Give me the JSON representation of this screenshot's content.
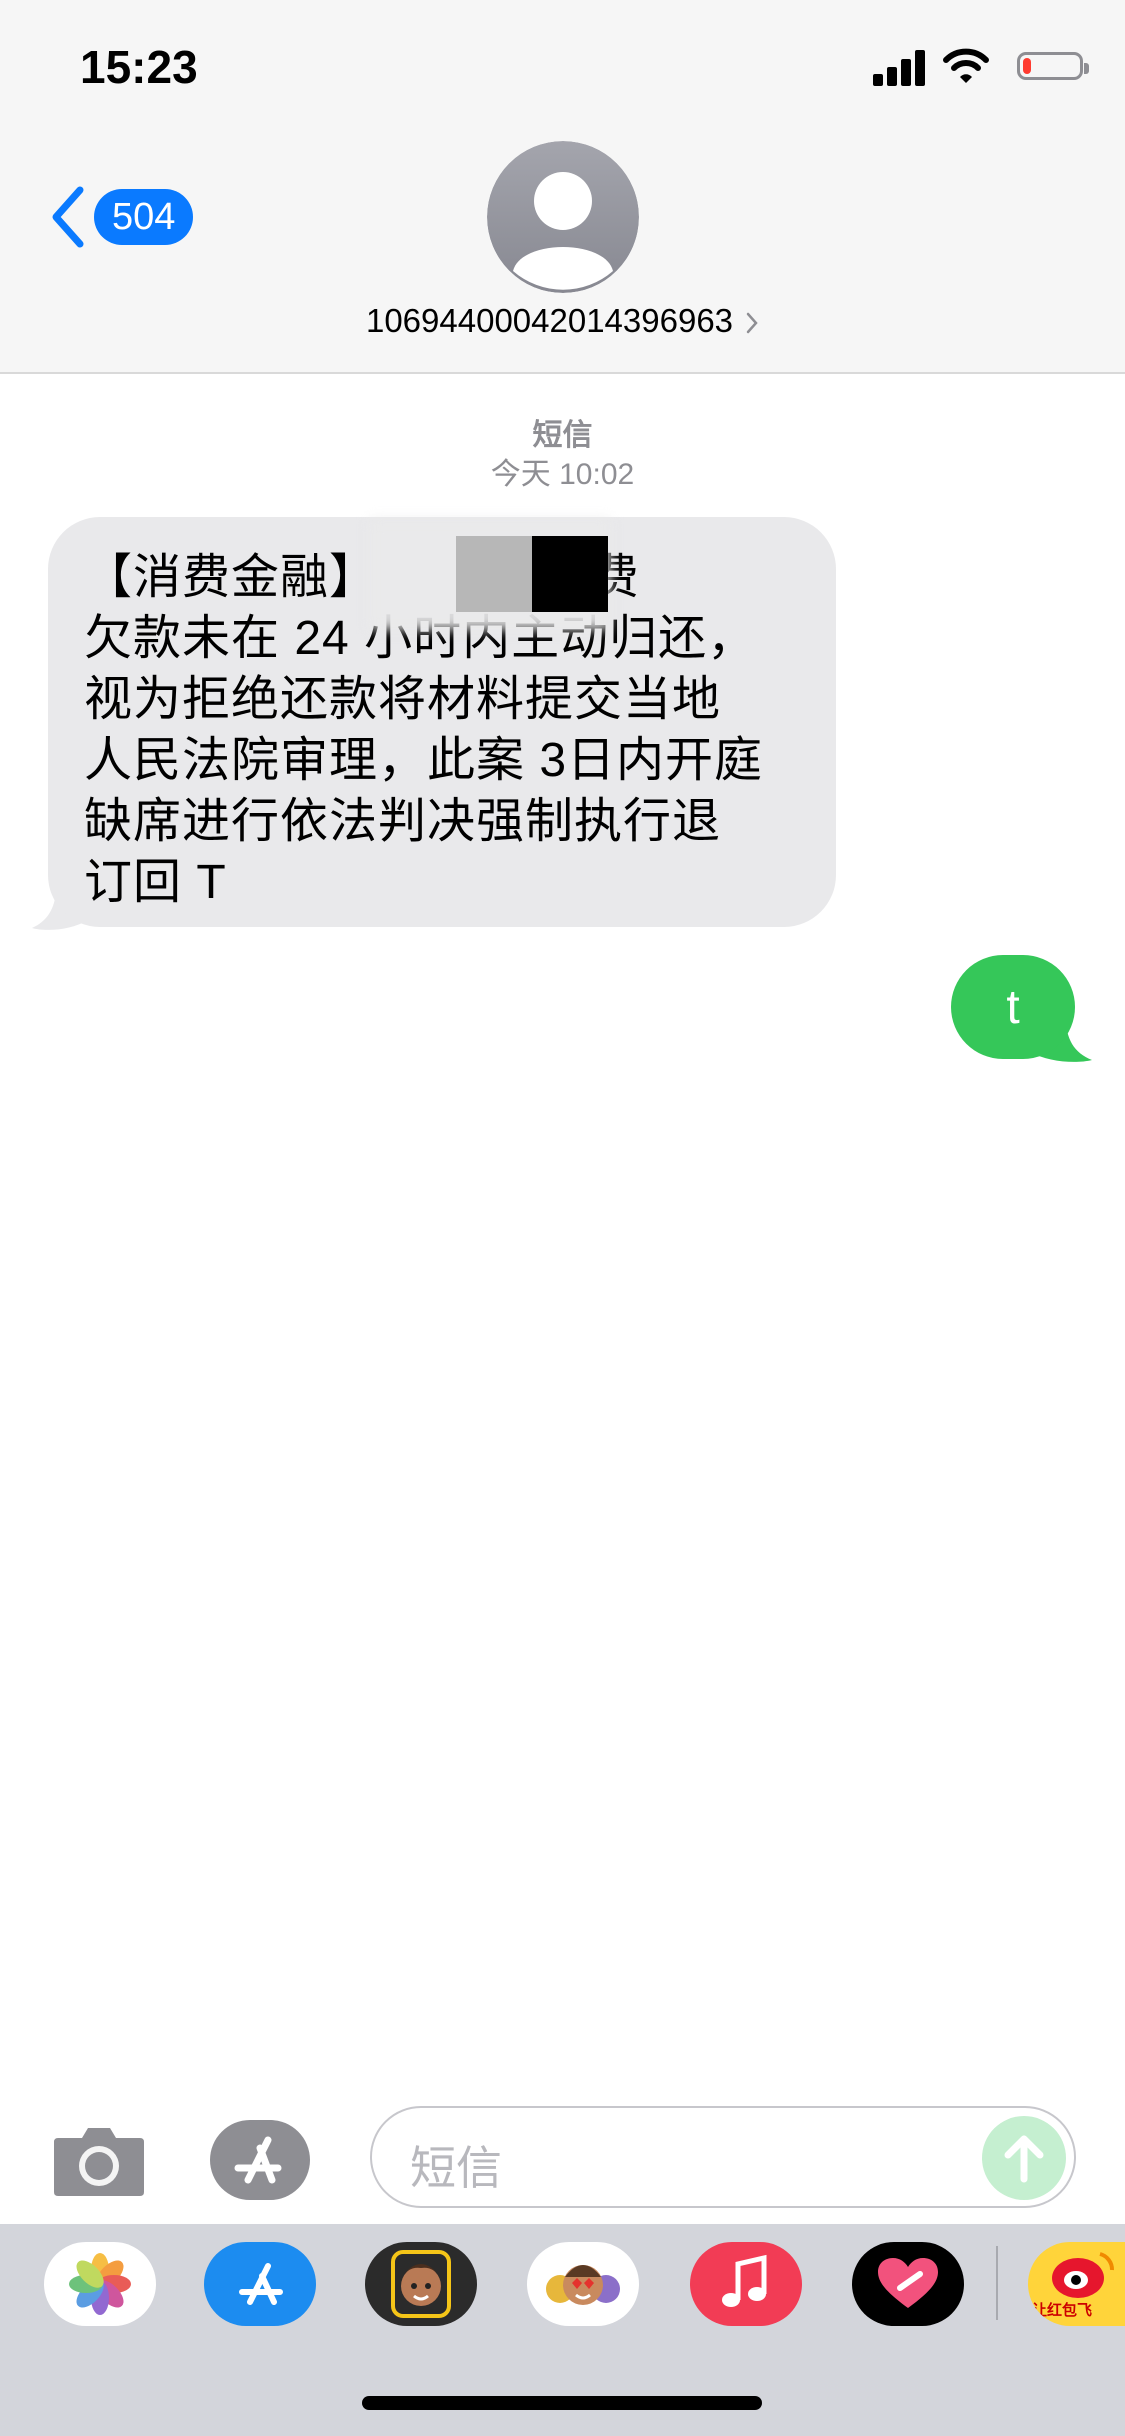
{
  "status_bar": {
    "time": "15:23",
    "icons": [
      "cellular-signal-icon",
      "wifi-icon",
      "battery-low-icon"
    ],
    "battery_level": 0.15,
    "battery_color": "#ff3b30"
  },
  "nav": {
    "back_count": "504",
    "back_icon": "chevron-left-icon",
    "avatar_icon": "person-icon",
    "contact_number": "10694400042014396963",
    "contact_chevron_icon": "chevron-right-icon"
  },
  "conversation": {
    "service_label": "短信",
    "timestamp": "今天 10:02",
    "messages": [
      {
        "direction": "incoming",
        "lines": [
          "【消费金融】        物消费",
          "欠款未在 24 小时内主动归还，",
          "视为拒绝还款将材料提交当地",
          "人民法院审理，此案 3日内开庭",
          "缺席进行依法判决强制执行退",
          "订回 T"
        ],
        "redacted": true,
        "bubble_color": "#e9e9eb"
      },
      {
        "direction": "outgoing",
        "text": "t",
        "bubble_color": "#35c759"
      }
    ]
  },
  "input_bar": {
    "camera_icon": "camera-icon",
    "apps_icon": "app-store-icon",
    "placeholder": "短信",
    "send_icon": "arrow-up-icon"
  },
  "app_drawer": {
    "apps": [
      {
        "name": "photos",
        "icon": "photos-icon"
      },
      {
        "name": "app-store",
        "icon": "app-store-icon"
      },
      {
        "name": "memoji",
        "icon": "memoji-icon"
      },
      {
        "name": "memoji-stickers",
        "icon": "memoji-stickers-icon"
      },
      {
        "name": "music",
        "icon": "music-icon"
      },
      {
        "name": "digital-touch",
        "icon": "heart-icon"
      },
      {
        "name": "weibo",
        "icon": "weibo-icon",
        "label": "让红包飞"
      }
    ]
  }
}
